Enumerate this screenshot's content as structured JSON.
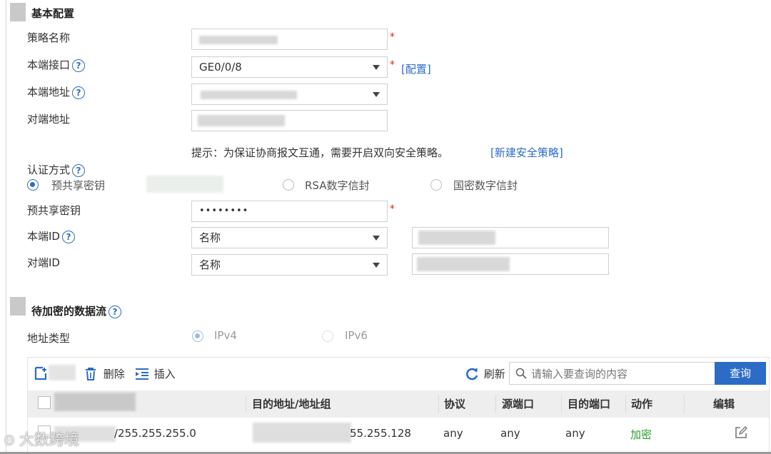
{
  "basic": {
    "title": "基本配置",
    "policy_name_label": "策略名称",
    "local_interface_label": "本端接口",
    "local_interface_value": "GE0/0/8",
    "configure_link": "[配置]",
    "local_address_label": "本端地址",
    "peer_address_label": "对端地址",
    "hint_text": "提示：为保证协商报文互通，需要开启双向安全策略。",
    "new_policy_link": "[新建安全策略]",
    "auth_method_label": "认证方式",
    "auth_options": [
      "预共享密钥",
      "RSA数字信封",
      "国密数字信封"
    ],
    "auth_selected": "预共享密钥",
    "psk_label": "预共享密钥",
    "psk_value": "••••••••",
    "local_id_label": "本端ID",
    "local_id_type": "名称",
    "peer_id_label": "对端ID",
    "peer_id_type": "名称",
    "required_mark": "*"
  },
  "flow": {
    "title": "待加密的数据流",
    "addr_type_label": "地址类型",
    "addr_types": [
      "IPv4",
      "IPv6"
    ],
    "addr_type_selected": "IPv4",
    "toolbar": {
      "delete_label": "删除",
      "insert_label": "插入",
      "refresh_label": "刷新",
      "search_placeholder": "请输入要查询的内容",
      "query_button": "查询"
    },
    "table": {
      "columns": [
        "目的地址/地址组",
        "协议",
        "源端口",
        "目的端口",
        "动作",
        "编辑"
      ],
      "rows": [
        {
          "src_suffix": "/255.255.255.0",
          "dst_suffix": "55.255.128",
          "protocol": "any",
          "src_port": "any",
          "dst_port": "any",
          "action": "加密"
        }
      ]
    }
  },
  "watermark": "大数跨境",
  "colors": {
    "accent": "#2c6cc6",
    "required": "#e02020",
    "action_encrypt": "#2aa02a",
    "query_button": "#2c6cc6"
  }
}
